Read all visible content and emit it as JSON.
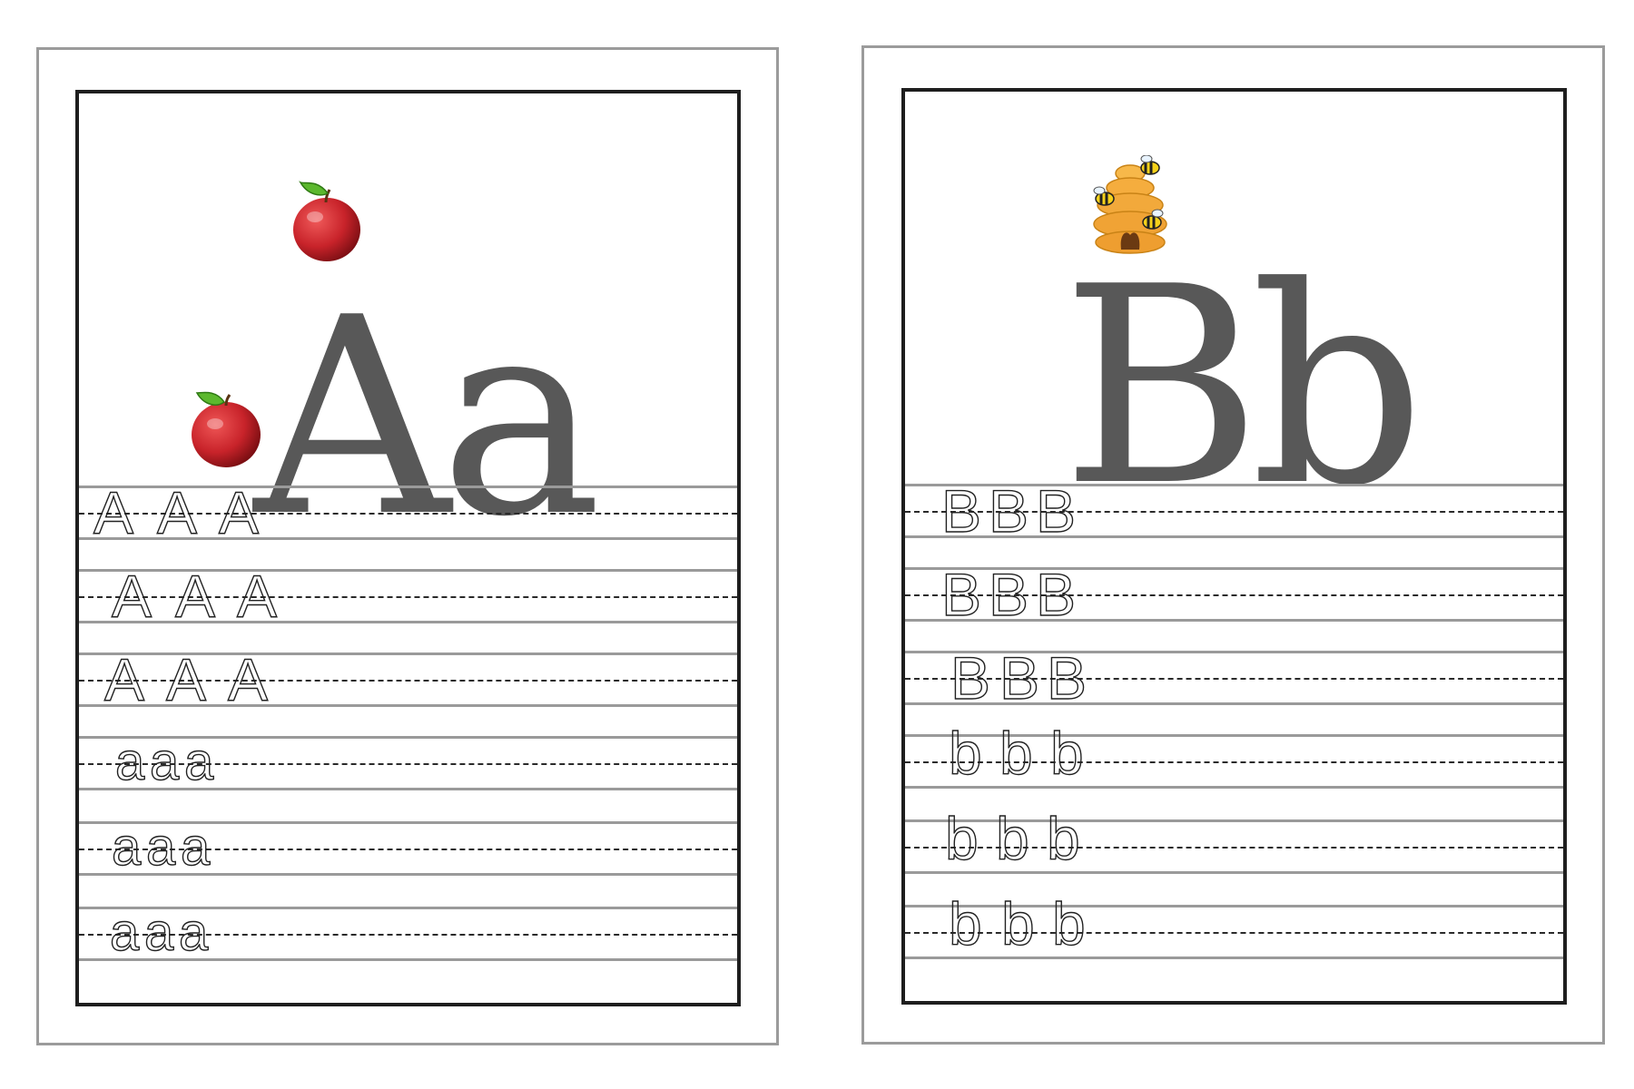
{
  "cards": [
    {
      "big_letters": "Aa",
      "picture_icon": "apple-icon",
      "trace_rows": [
        {
          "letters": [
            "A",
            "A",
            "A"
          ]
        },
        {
          "letters": [
            "A",
            "A",
            "A"
          ]
        },
        {
          "letters": [
            "A",
            "A",
            "A"
          ]
        },
        {
          "letters": [
            "a",
            "a",
            "a"
          ]
        },
        {
          "letters": [
            "a",
            "a",
            "a"
          ]
        },
        {
          "letters": [
            "a",
            "a",
            "a"
          ]
        }
      ]
    },
    {
      "big_letters": "Bb",
      "picture_icon": "beehive-icon",
      "trace_rows": [
        {
          "letters": [
            "B",
            "B",
            "B"
          ]
        },
        {
          "letters": [
            "B",
            "B",
            "B"
          ]
        },
        {
          "letters": [
            "B",
            "B",
            "B"
          ]
        },
        {
          "letters": [
            "b",
            "b",
            "b"
          ]
        },
        {
          "letters": [
            "b",
            "b",
            "b"
          ]
        },
        {
          "letters": [
            "b",
            "b",
            "b"
          ]
        }
      ]
    }
  ],
  "colors": {
    "sheet_border": "#9b9b9b",
    "card_border": "#1e1e1e",
    "big_letter": "#585858",
    "rule_line": "#9a9a9a",
    "apple_red": "#c8232a",
    "honey": "#f2a93b"
  }
}
